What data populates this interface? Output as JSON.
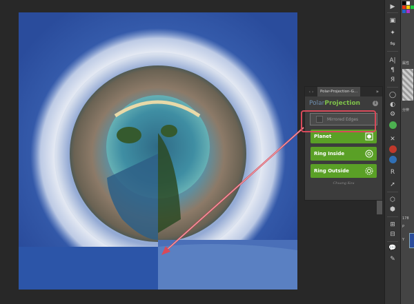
{
  "panel": {
    "tab_title": "Polar-Projection-G...",
    "nav_back": "‹",
    "nav_fwd": "›",
    "menu": "»",
    "title_part1": "Polar",
    "title_part2": "Projection",
    "info_glyph": "i",
    "mirrored_label": "Mirrored Edges",
    "buttons": [
      {
        "label": "Planet",
        "icon": "planet-icon"
      },
      {
        "label": "Ring Inside",
        "icon": "ring-inside-icon"
      },
      {
        "label": "Ring Outside",
        "icon": "ring-outside-icon"
      }
    ],
    "logo_text": "Chuang Kou"
  },
  "toolbar": {
    "icons": [
      "play-icon",
      "color-swatch-icon",
      "layers-icon",
      "brush-icon",
      "adjust-icon",
      "type-icon",
      "paragraph-icon",
      "glyph-icon",
      "circle-icon",
      "gear-icon",
      "green-badge-icon",
      "tools-icon",
      "ra-red-icon",
      "ra-blue-icon",
      "r-icon",
      "arrow-icon",
      "cube-icon",
      "dark-cube-icon",
      "grid-icon",
      "grid2-icon",
      "comment-icon",
      "pen-icon"
    ]
  },
  "right_panel": {
    "label1": "属性",
    "label2": "分辨",
    "label3": "178",
    "label4": "P",
    "label5": "Y"
  },
  "colors": {
    "accent_green": "#5aa026",
    "highlight": "#d84a5a",
    "title_blue": "#6f8fb0",
    "title_green": "#7fc24a"
  }
}
